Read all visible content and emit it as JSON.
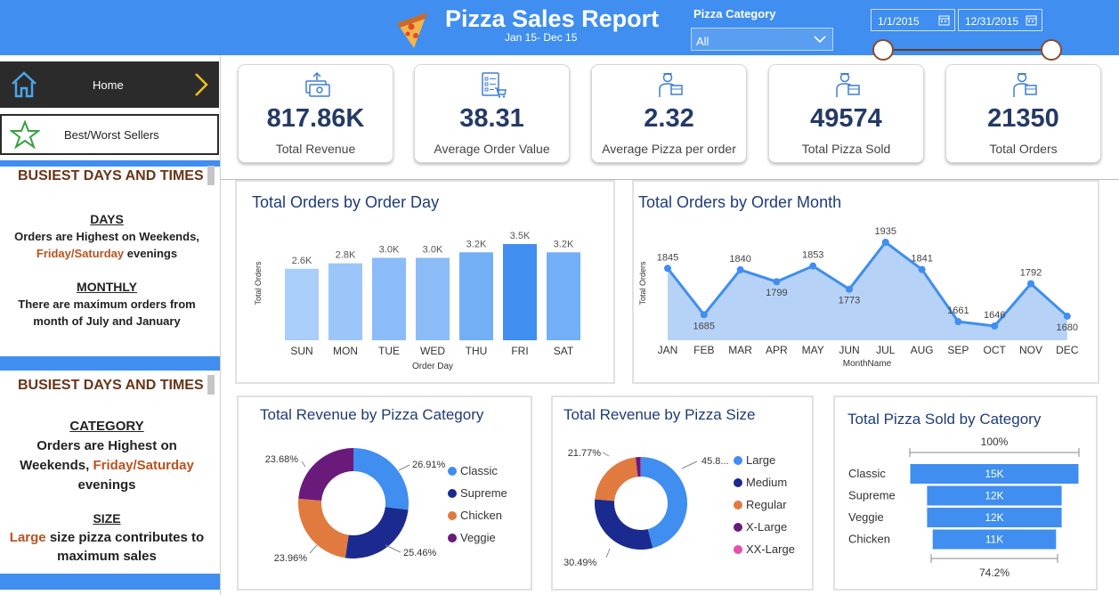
{
  "header": {
    "title": "Pizza Sales Report",
    "subtitle": "Jan 15- Dec 15",
    "category_label": "Pizza Category",
    "category_value": "All",
    "date_start": "1/1/2015",
    "date_end": "12/31/2015",
    "accent_color": "#3f8ef0"
  },
  "sidebar": {
    "nav": [
      {
        "label": "Home",
        "icon": "home-icon"
      },
      {
        "label": "Best/Worst Sellers",
        "icon": "star-icon"
      }
    ],
    "section1": {
      "title": "BUSIEST DAYS AND TIMES",
      "days_head": "DAYS",
      "days_line1": "Orders are Highest on Weekends,",
      "days_line2a": "Friday/Saturday",
      "days_line2b": " evenings",
      "monthly_head": "MONTHLY",
      "monthly_line1": "There are maximum orders from",
      "monthly_line2": "month  of July and January"
    },
    "section2": {
      "title": "BUSIEST DAYS AND TIMES",
      "category_head": "CATEGORY",
      "category_line1": "Orders are Highest on",
      "category_line2a": "Weekends, ",
      "category_line2b": "Friday/Saturday",
      "category_line3": "evenings",
      "size_head": "SIZE",
      "size_line1a": "Large",
      "size_line1b": " size pizza contributes to",
      "size_line2": "maximum sales"
    }
  },
  "kpis": [
    {
      "value": "817.86K",
      "label": "Total Revenue",
      "icon": "money-icon"
    },
    {
      "value": "38.31",
      "label": "Average Order Value",
      "icon": "checklist-cart-icon"
    },
    {
      "value": "2.32",
      "label": "Average Pizza per order",
      "icon": "delivery-person-icon"
    },
    {
      "value": "49574",
      "label": "Total Pizza Sold",
      "icon": "delivery-person-icon"
    },
    {
      "value": "21350",
      "label": "Total Orders",
      "icon": "delivery-person-icon"
    }
  ],
  "chart_data": [
    {
      "type": "bar",
      "title": "Total Orders by Order Day",
      "xlabel": "Order Day",
      "ylabel": "Total Orders",
      "categories": [
        "SUN",
        "MON",
        "TUE",
        "WED",
        "THU",
        "FRI",
        "SAT"
      ],
      "values": [
        2600,
        2800,
        3000,
        3000,
        3200,
        3500,
        3200
      ],
      "data_labels": [
        "2.6K",
        "2.8K",
        "3.0K",
        "3.0K",
        "3.2K",
        "3.5K",
        "3.2K"
      ],
      "colors": [
        "#a9cefa",
        "#9cc6f9",
        "#8bbcf8",
        "#8bbcf8",
        "#73aff7",
        "#3f8ef0",
        "#73aff7"
      ],
      "ylim": [
        0,
        3500
      ]
    },
    {
      "type": "area",
      "title": "Total Orders by Order Month",
      "xlabel": "MonthName",
      "ylabel": "Total Orders",
      "categories": [
        "JAN",
        "FEB",
        "MAR",
        "APR",
        "MAY",
        "JUN",
        "JUL",
        "AUG",
        "SEP",
        "OCT",
        "NOV",
        "DEC"
      ],
      "values": [
        1845,
        1685,
        1840,
        1799,
        1853,
        1773,
        1935,
        1841,
        1661,
        1646,
        1792,
        1680
      ],
      "line_color": "#3f8ef0",
      "fill_color": "#b7d2f7"
    },
    {
      "type": "pie",
      "title": "Total Revenue by Pizza Category",
      "labels": [
        "Classic",
        "Supreme",
        "Chicken",
        "Veggie"
      ],
      "values": [
        26.91,
        25.46,
        23.96,
        23.68
      ],
      "value_labels": [
        "26.91%",
        "25.46%",
        "23.96%",
        "23.68%"
      ],
      "colors": [
        "#3f8ef0",
        "#1b2a8f",
        "#e07a3f",
        "#6a1a7a"
      ]
    },
    {
      "type": "pie",
      "title": "Total Revenue by Pizza Size",
      "labels": [
        "Large",
        "Medium",
        "Regular",
        "X-Large",
        "XX-Large"
      ],
      "values": [
        45.89,
        30.49,
        21.77,
        1.72,
        0.13
      ],
      "value_labels": [
        "45.8...",
        "30.49%",
        "21.77%",
        "",
        ""
      ],
      "colors": [
        "#3f8ef0",
        "#1b2a8f",
        "#e07a3f",
        "#6a1a7a",
        "#e84fa8"
      ]
    },
    {
      "type": "bar",
      "title": "Total Pizza Sold by Category",
      "categories": [
        "Classic",
        "Supreme",
        "Veggie",
        "Chicken"
      ],
      "values": [
        15000,
        12000,
        12000,
        11000
      ],
      "data_labels": [
        "15K",
        "12K",
        "12K",
        "11K"
      ],
      "top_label": "100%",
      "bottom_label": "74.2%",
      "color": "#3f8ef0"
    }
  ]
}
